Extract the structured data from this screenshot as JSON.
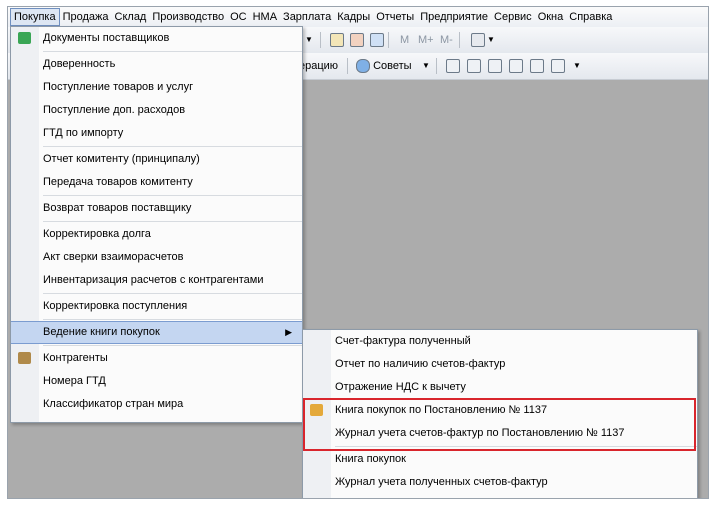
{
  "menubar": [
    "Покупка",
    "Продажа",
    "Склад",
    "Производство",
    "ОС",
    "НМА",
    "Зарплата",
    "Кадры",
    "Отчеты",
    "Предприятие",
    "Сервис",
    "Окна",
    "Справка"
  ],
  "toolbar": {
    "m_label": "М",
    "mplus_label": "М+",
    "mminus_label": "М-",
    "operation_partial": "ерацию",
    "tips_label": "Советы"
  },
  "main_menu": {
    "items": [
      "Документы поставщиков",
      "Доверенность",
      "Поступление товаров и услуг",
      "Поступление доп. расходов",
      "ГТД по импорту",
      "Отчет комитенту (принципалу)",
      "Передача товаров комитенту",
      "Возврат товаров поставщику",
      "Корректировка долга",
      "Акт сверки взаиморасчетов",
      "Инвентаризация расчетов с контрагентами",
      "Корректировка поступления",
      "Ведение книги покупок",
      "Контрагенты",
      "Номера ГТД",
      "Классификатор стран мира"
    ]
  },
  "submenu": {
    "items": [
      "Счет-фактура полученный",
      "Отчет по наличию счетов-фактур",
      "Отражение НДС к вычету",
      "Книга покупок по Постановлению № 1137",
      "Журнал учета счетов-фактур по Постановлению № 1137",
      "Книга покупок",
      "Журнал учета полученных счетов-фактур"
    ]
  },
  "colors": {
    "highlight_border": "#d9252c",
    "menu_highlight": "#c4d6f1"
  }
}
